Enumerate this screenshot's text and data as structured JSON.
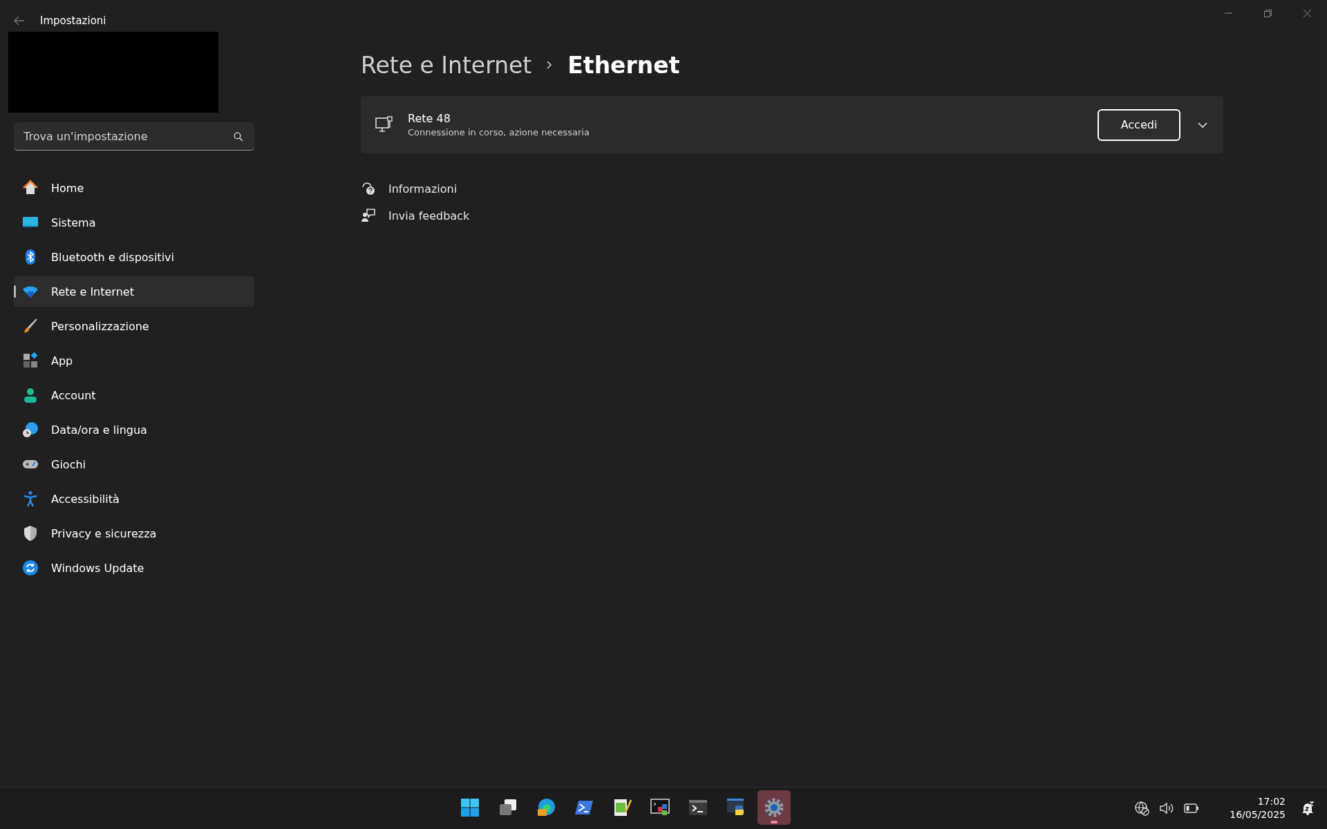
{
  "window": {
    "title": "Impostazioni"
  },
  "search": {
    "placeholder": "Trova un'impostazione"
  },
  "nav": [
    {
      "label": "Home",
      "kind": "home",
      "selected": false
    },
    {
      "label": "Sistema",
      "kind": "system",
      "selected": false
    },
    {
      "label": "Bluetooth e dispositivi",
      "kind": "bluetooth",
      "selected": false
    },
    {
      "label": "Rete e Internet",
      "kind": "network",
      "selected": true
    },
    {
      "label": "Personalizzazione",
      "kind": "brush",
      "selected": false
    },
    {
      "label": "App",
      "kind": "apps",
      "selected": false
    },
    {
      "label": "Account",
      "kind": "account",
      "selected": false
    },
    {
      "label": "Data/ora e lingua",
      "kind": "time",
      "selected": false
    },
    {
      "label": "Giochi",
      "kind": "games",
      "selected": false
    },
    {
      "label": "Accessibilità",
      "kind": "access",
      "selected": false
    },
    {
      "label": "Privacy e sicurezza",
      "kind": "shield",
      "selected": false
    },
    {
      "label": "Windows Update",
      "kind": "update",
      "selected": false
    }
  ],
  "breadcrumb": [
    "Rete e Internet",
    "Ethernet"
  ],
  "network_card": {
    "name": "Rete 48",
    "status": "Connessione in corso, azione necessaria",
    "button": "Accedi",
    "expanded": false
  },
  "links": [
    {
      "label": "Informazioni",
      "kind": "help"
    },
    {
      "label": "Invia feedback",
      "kind": "feedback"
    }
  ],
  "taskbar": {
    "apps": [
      {
        "kind": "start",
        "selected": false
      },
      {
        "kind": "taskview",
        "selected": false
      },
      {
        "kind": "browser",
        "selected": false
      },
      {
        "kind": "powershell",
        "selected": false
      },
      {
        "kind": "notepad",
        "selected": false
      },
      {
        "kind": "terminal-blocks",
        "selected": false
      },
      {
        "kind": "terminal",
        "selected": false
      },
      {
        "kind": "python",
        "selected": false
      },
      {
        "kind": "settings",
        "selected": true
      }
    ],
    "time": "17:02",
    "date": "16/05/2025"
  }
}
